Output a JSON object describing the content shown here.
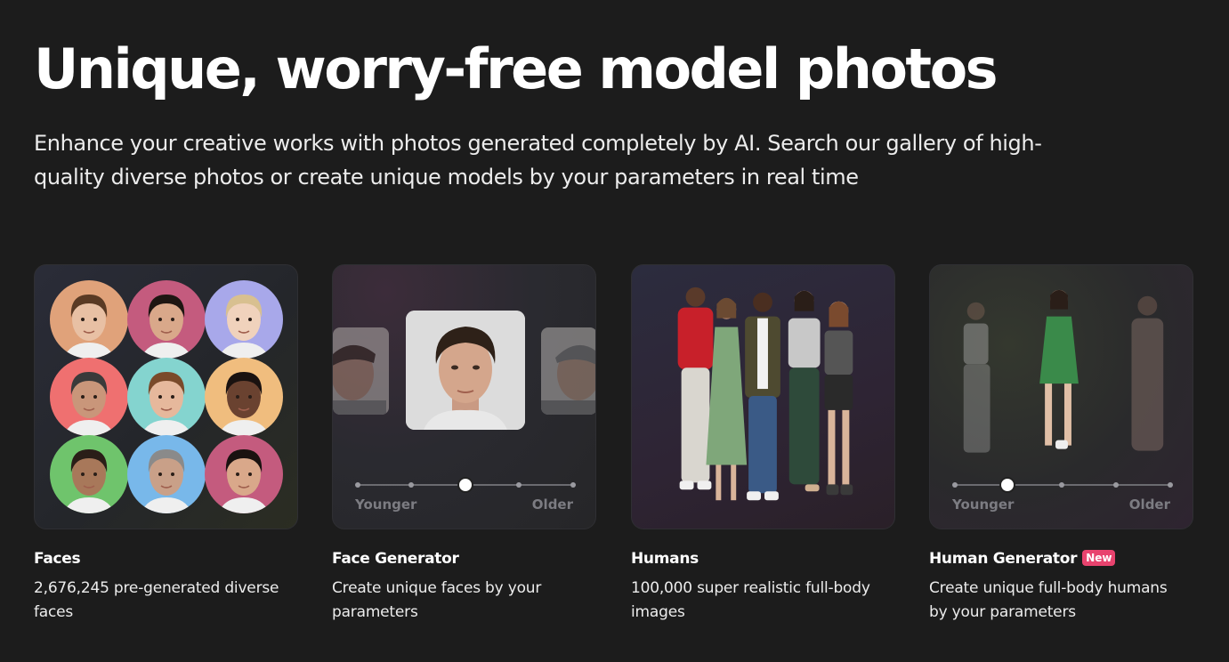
{
  "hero": {
    "title": "Unique, worry-free model photos",
    "subtitle": "Enhance your creative works with photos generated completely by AI. Search our gallery of high-quality diverse photos or create unique models by your parameters in real time"
  },
  "cards": [
    {
      "title": "Faces",
      "description": "2,676,245 pre-generated diverse faces"
    },
    {
      "title": "Face Generator",
      "description": "Create unique faces by your parameters",
      "slider": {
        "min_label": "Younger",
        "max_label": "Older",
        "value_fraction": 0.5
      }
    },
    {
      "title": "Humans",
      "description": "100,000 super realistic full-body images"
    },
    {
      "title": "Human Generator",
      "badge": "New",
      "description": "Create unique full-body humans by your parameters",
      "slider": {
        "min_label": "Younger",
        "max_label": "Older",
        "value_fraction": 0.25
      }
    }
  ],
  "colors": {
    "background": "#1c1c1c",
    "badge": "#e8436e",
    "face_backgrounds": [
      "#e0a27a",
      "#c45b7e",
      "#a8a8ea",
      "#ef7070",
      "#84d4cf",
      "#f0bd7e",
      "#6fc46c",
      "#78b8ea",
      "#c45b7e"
    ]
  },
  "icons": [
    "hand-cursor-icon"
  ]
}
